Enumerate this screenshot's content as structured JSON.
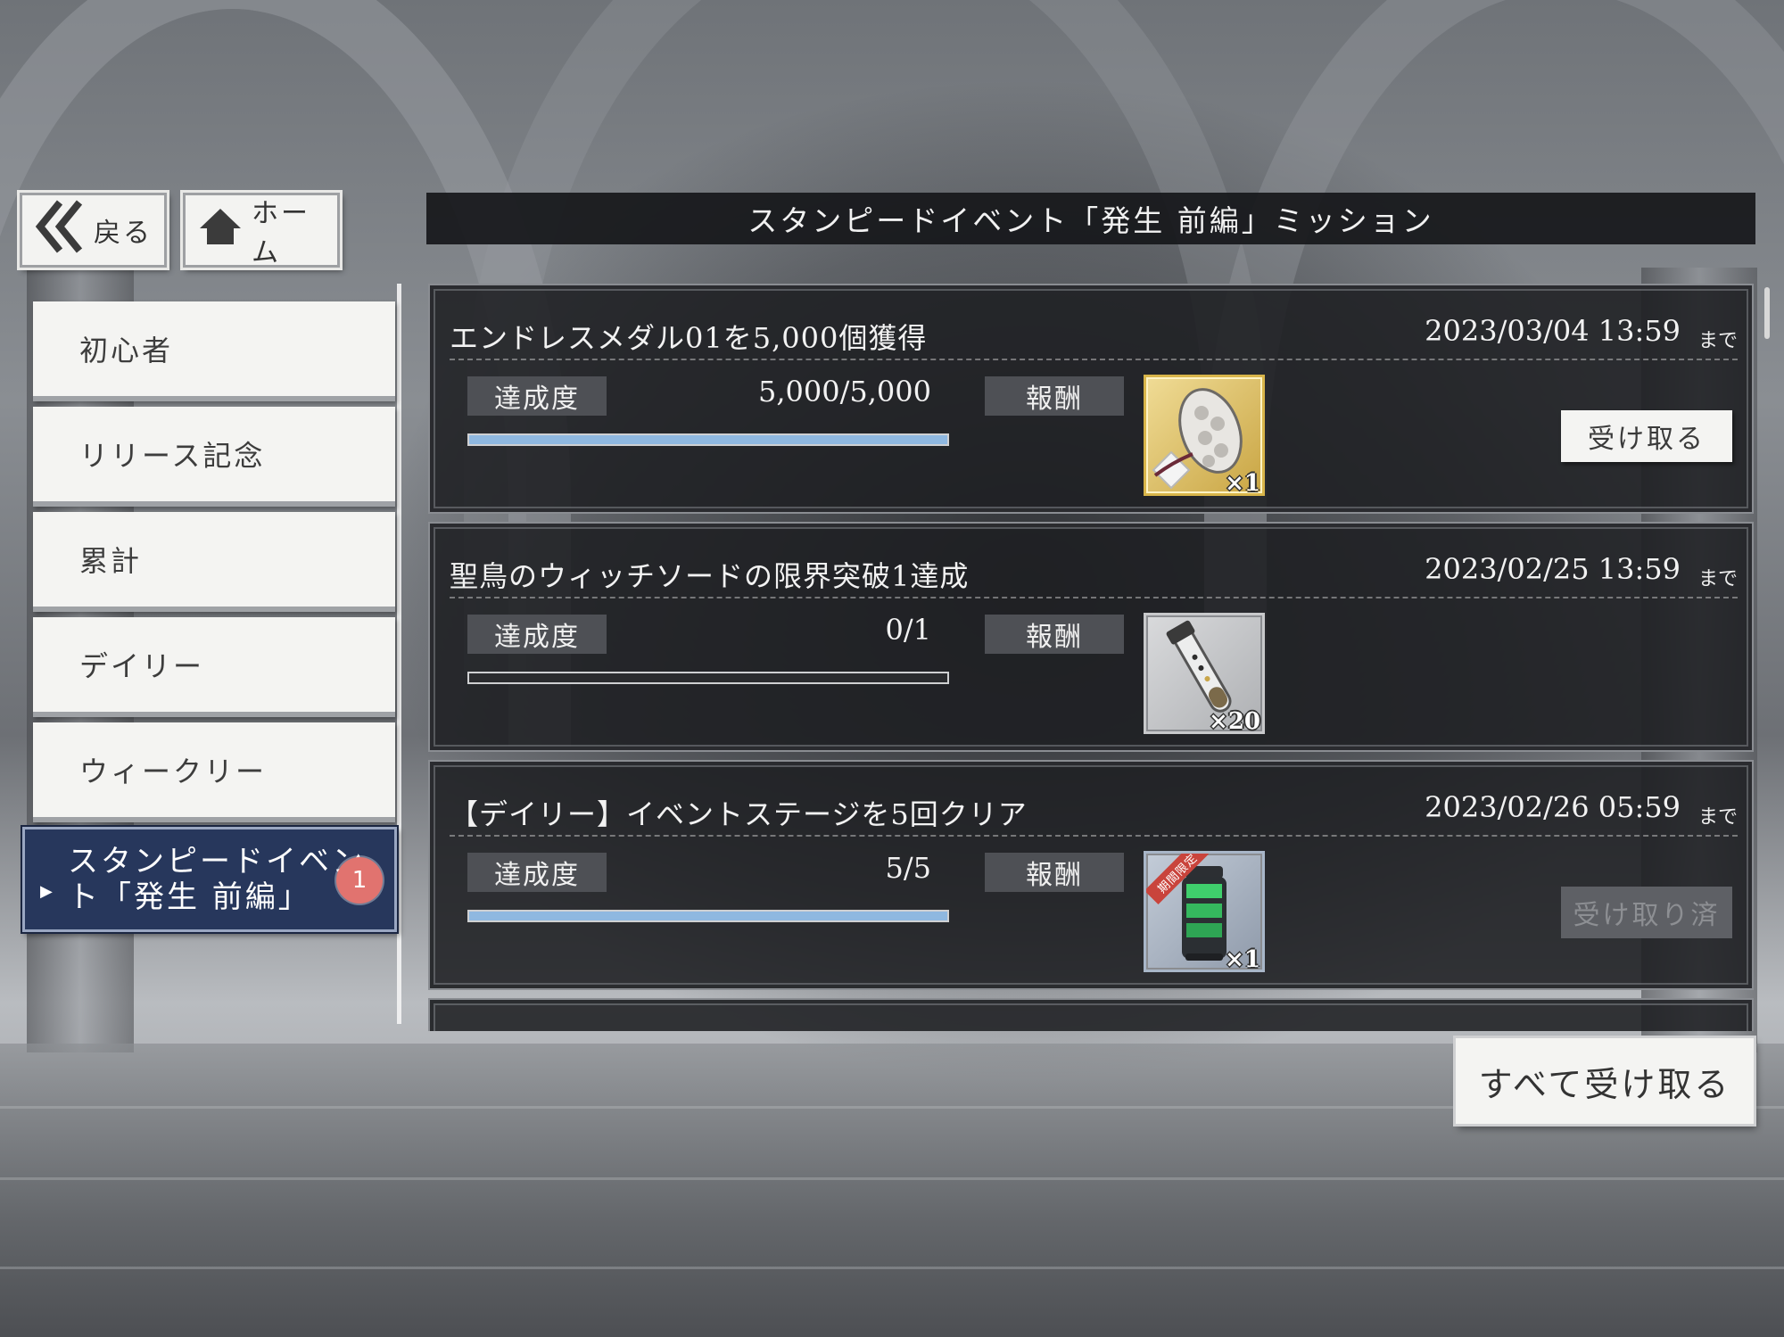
{
  "nav": {
    "back_label": "戻る",
    "home_label": "ホーム"
  },
  "header": {
    "title": "スタンピードイベント「発生 前編」ミッション"
  },
  "sidebar": {
    "items": [
      {
        "label": "初心者"
      },
      {
        "label": "リリース記念"
      },
      {
        "label": "累計"
      },
      {
        "label": "デイリー"
      },
      {
        "label": "ウィークリー"
      },
      {
        "label_line1": "スタンピードイベン",
        "label_line2": "ト「発生 前編」",
        "badge": "1",
        "active": true
      }
    ]
  },
  "missions": [
    {
      "title": "エンドレスメダル01を5,000個獲得",
      "deadline": "2023/03/04 13:59",
      "until": "まで",
      "progress_label": "達成度",
      "count": "5,000/5,000",
      "progress": 1.0,
      "reward_label": "報酬",
      "reward_icon": "gauntlet-weapon-icon",
      "reward_qty": "×1",
      "action": "受け取る",
      "action_state": "claimable"
    },
    {
      "title": "聖鳥のウィッチソードの限界突破1達成",
      "deadline": "2023/02/25 13:59",
      "until": "まで",
      "progress_label": "達成度",
      "count": "0/1",
      "progress": 0.0,
      "reward_label": "報酬",
      "reward_icon": "test-tube-icon",
      "reward_qty": "×20"
    },
    {
      "title": "【デイリー】イベントステージを5回クリア",
      "deadline": "2023/02/26 05:59",
      "until": "まで",
      "progress_label": "達成度",
      "count": "5/5",
      "progress": 1.0,
      "reward_label": "報酬",
      "reward_icon": "green-canister-icon",
      "reward_ribbon": "期間限定",
      "reward_qty": "×1",
      "action": "受け取り済",
      "action_state": "claimed"
    }
  ],
  "footer": {
    "claim_all_label": "すべて受け取る"
  },
  "colors": {
    "progress_fill": "#8fb8e0",
    "active_tab": "#27375c",
    "badge": "#e1736f",
    "gold_frame": "#d8b54a"
  }
}
